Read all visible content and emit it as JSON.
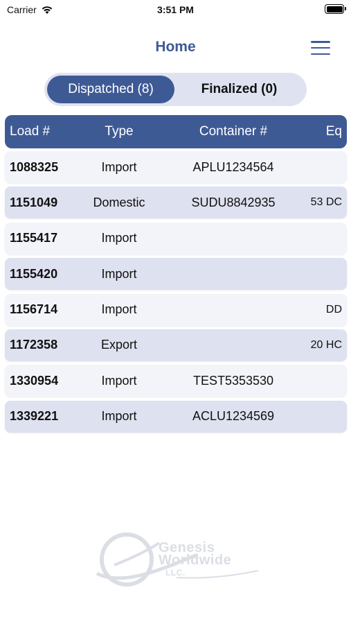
{
  "status_bar": {
    "carrier": "Carrier",
    "time": "3:51 PM"
  },
  "nav": {
    "title": "Home"
  },
  "tabs": [
    {
      "label": "Dispatched (8)",
      "active": true
    },
    {
      "label": "Finalized (0)",
      "active": false
    }
  ],
  "table": {
    "columns": [
      "Load #",
      "Type",
      "Container #",
      "Eq"
    ],
    "rows": [
      {
        "load": "1088325",
        "type": "Import",
        "container": "APLU1234564",
        "eq": ""
      },
      {
        "load": "1151049",
        "type": "Domestic",
        "container": "SUDU8842935",
        "eq": "53 DC"
      },
      {
        "load": "1155417",
        "type": "Import",
        "container": "",
        "eq": ""
      },
      {
        "load": "1155420",
        "type": "Import",
        "container": "",
        "eq": ""
      },
      {
        "load": "1156714",
        "type": "Import",
        "container": "",
        "eq": "DD"
      },
      {
        "load": "1172358",
        "type": "Export",
        "container": "",
        "eq": "20 HC"
      },
      {
        "load": "1330954",
        "type": "Import",
        "container": "TEST5353530",
        "eq": ""
      },
      {
        "load": "1339221",
        "type": "Import",
        "container": "ACLU1234569",
        "eq": ""
      }
    ]
  },
  "watermark": {
    "line1": "Genesis",
    "line2": "Worldwide",
    "line3": "LLC."
  },
  "colors": {
    "primary": "#3e5a95",
    "row_light": "#f3f4fa",
    "row_dark": "#dee1ef",
    "segment_bg": "#dfe3f1"
  }
}
